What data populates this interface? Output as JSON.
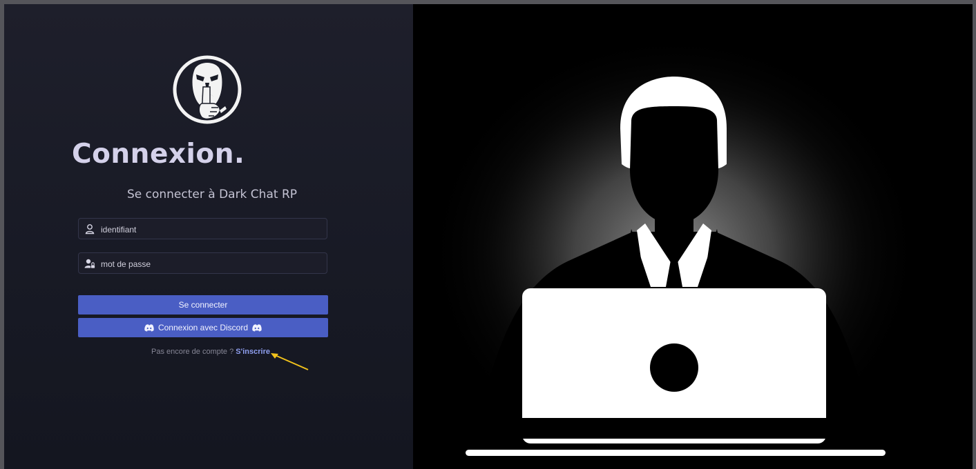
{
  "login": {
    "title": "Connexion.",
    "subtitle": "Se connecter à Dark Chat RP",
    "username": {
      "placeholder": "identifiant",
      "value": "",
      "icon": "user-icon"
    },
    "password": {
      "placeholder": "mot de passe",
      "value": "",
      "icon": "user-lock-icon"
    },
    "submit_label": "Se connecter",
    "discord_label": "Connexion avec Discord",
    "no_account_text": "Pas encore de compte ?",
    "signup_label": "S'inscrire"
  },
  "colors": {
    "accent": "#4a5ec4",
    "link": "#8f9ff0",
    "panel_bg": "#1a1c27",
    "annotation_arrow": "#f2c21b"
  }
}
